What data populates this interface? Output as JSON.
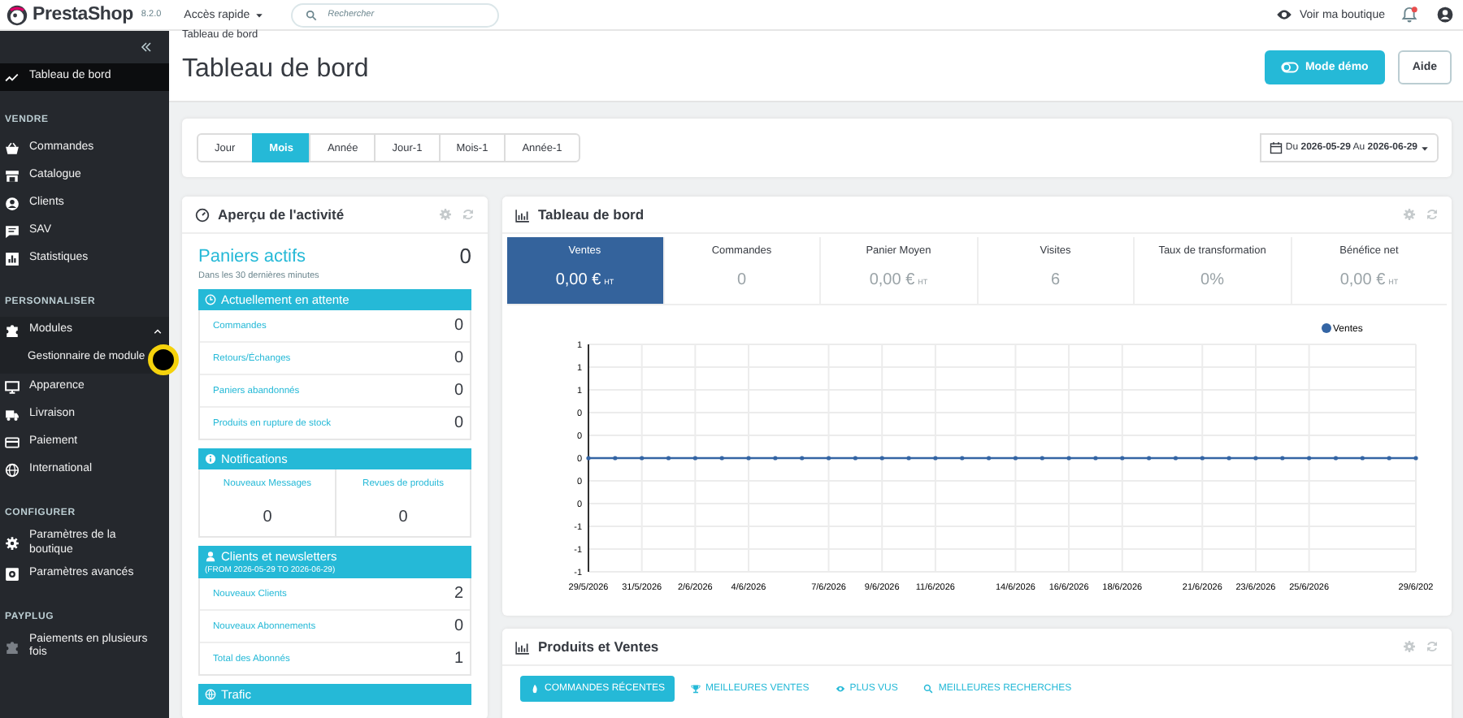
{
  "topbar": {
    "logo": "PrestaShop",
    "version": "8.2.0",
    "quick_access": "Accès rapide",
    "search": {
      "placeholder": "Rechercher"
    },
    "view_shop": "Voir ma boutique"
  },
  "sidebar": {
    "sections": [
      {
        "items": [
          {
            "label": "Tableau de bord",
            "selected": true
          }
        ]
      },
      {
        "title": "VENDRE",
        "items": [
          {
            "label": "Commandes",
            "selected": false
          },
          {
            "label": "Catalogue",
            "selected": false
          },
          {
            "label": "Clients",
            "selected": false
          },
          {
            "label": "SAV",
            "selected": false
          },
          {
            "label": "Statistiques",
            "selected": false
          }
        ]
      },
      {
        "title": "PERSONNALISER",
        "items": [
          {
            "label": "Modules",
            "selected": false,
            "expanded": true,
            "children": [
              {
                "label": "Gestionnaire de module",
                "selected": false
              }
            ]
          },
          {
            "label": "Apparence",
            "selected": false
          },
          {
            "label": "Livraison",
            "selected": false
          },
          {
            "label": "Paiement",
            "selected": false
          },
          {
            "label": "International",
            "selected": false
          }
        ]
      },
      {
        "title": "CONFIGURER",
        "items": [
          {
            "label": "Paramètres de la boutique",
            "selected": false
          },
          {
            "label": "Paramètres avancés",
            "selected": false
          }
        ]
      },
      {
        "title": "PAYPLUG",
        "items": [
          {
            "label": "Paiements en plusieurs fois",
            "selected": false
          }
        ]
      }
    ]
  },
  "page_header": {
    "breadcrumb": "Tableau de bord",
    "title": "Tableau de bord",
    "buttons": [
      {
        "label": "Mode démo",
        "kind": "primary"
      },
      {
        "label": "Aide",
        "kind": "default"
      }
    ]
  },
  "period_filter": {
    "periods": [
      {
        "label": "Jour",
        "selected": false
      },
      {
        "label": "Mois",
        "selected": true
      },
      {
        "label": "Année",
        "selected": false
      },
      {
        "label": "Jour-1",
        "selected": false
      },
      {
        "label": "Mois-1",
        "selected": false
      },
      {
        "label": "Année-1",
        "selected": false
      }
    ],
    "date_range": {
      "from_label": "Du",
      "from": "2026-05-29",
      "to_label": "Au",
      "to": "2026-06-29"
    }
  },
  "activity": {
    "title": "Aperçu de l'activité",
    "active_carts": {
      "label": "Paniers actifs",
      "value": "0",
      "note": "Dans les 30 dernières minutes"
    },
    "sections": [
      {
        "kind": "list",
        "title": "Actuellement en attente",
        "rows": [
          {
            "label": "Commandes",
            "value": "0"
          },
          {
            "label": "Retours/Échanges",
            "value": "0"
          },
          {
            "label": "Paniers abandonnés",
            "value": "0"
          },
          {
            "label": "Produits en rupture de stock",
            "value": "0"
          }
        ]
      },
      {
        "kind": "grid",
        "title": "Notifications",
        "cells": [
          {
            "label": "Nouveaux Messages",
            "value": "0"
          },
          {
            "label": "Revues de produits",
            "value": "0"
          }
        ]
      },
      {
        "kind": "list",
        "title": "Clients et newsletters",
        "subtitle": "(FROM 2026-05-29 TO 2026-06-29)",
        "rows": [
          {
            "label": "Nouveaux Clients",
            "value": "2"
          },
          {
            "label": "Nouveaux Abonnements",
            "value": "0"
          },
          {
            "label": "Total des Abonnés",
            "value": "1"
          }
        ]
      },
      {
        "kind": "list",
        "title": "Trafic"
      }
    ]
  },
  "dashboard": {
    "title": "Tableau de bord",
    "kpis": [
      {
        "label": "Ventes",
        "value": "0,00 €",
        "unit": "HT",
        "selected": true
      },
      {
        "label": "Commandes",
        "value": "0",
        "selected": false
      },
      {
        "label": "Panier Moyen",
        "value": "0,00 €",
        "unit": "HT",
        "selected": false
      },
      {
        "label": "Visites",
        "value": "6",
        "selected": false
      },
      {
        "label": "Taux de transformation",
        "value": "0%",
        "selected": false
      },
      {
        "label": "Bénéfice net",
        "value": "0,00 €",
        "unit": "HT",
        "selected": false
      }
    ],
    "chart_data": {
      "type": "line",
      "grid": true,
      "categories": [
        "29/5/2026",
        null,
        "31/5/2026",
        null,
        "2/6/2026",
        null,
        "4/6/2026",
        null,
        null,
        "7/6/2026",
        null,
        "9/6/2026",
        null,
        "11/6/2026",
        null,
        null,
        "14/6/2026",
        null,
        "16/6/2026",
        null,
        "18/6/2026",
        null,
        null,
        "21/6/2026",
        null,
        "23/6/2026",
        null,
        "25/6/2026",
        null,
        null,
        null,
        "29/6/202"
      ],
      "ylim": [
        -1,
        1
      ],
      "series": [
        {
          "name": "Ventes",
          "color": "#3465a4",
          "values": [
            0,
            0,
            0,
            0,
            0,
            0,
            0,
            0,
            0,
            0,
            0,
            0,
            0,
            0,
            0,
            0,
            0,
            0,
            0,
            0,
            0,
            0,
            0,
            0,
            0,
            0,
            0,
            0,
            0,
            0,
            0,
            0
          ]
        }
      ],
      "yticks": [
        {
          "value": 1,
          "label": "1"
        },
        {
          "value": 0.8,
          "label": "1"
        },
        {
          "value": 0.6,
          "label": "1"
        },
        {
          "value": 0.4,
          "label": "0"
        },
        {
          "value": 0.2,
          "label": "0"
        },
        {
          "value": 0,
          "label": "0"
        },
        {
          "value": -0.2,
          "label": "0"
        },
        {
          "value": -0.4,
          "label": "0"
        },
        {
          "value": -0.6,
          "label": "-1"
        },
        {
          "value": -0.8,
          "label": "-1"
        },
        {
          "value": -1,
          "label": "-1"
        }
      ]
    }
  },
  "products_sales": {
    "title": "Produits et Ventes",
    "tabs": [
      {
        "label": "COMMANDES RÉCENTES",
        "selected": true
      },
      {
        "label": "MEILLEURES VENTES",
        "selected": false
      },
      {
        "label": "PLUS VUS",
        "selected": false
      },
      {
        "label": "MEILLEURES RECHERCHES",
        "selected": false
      }
    ]
  }
}
